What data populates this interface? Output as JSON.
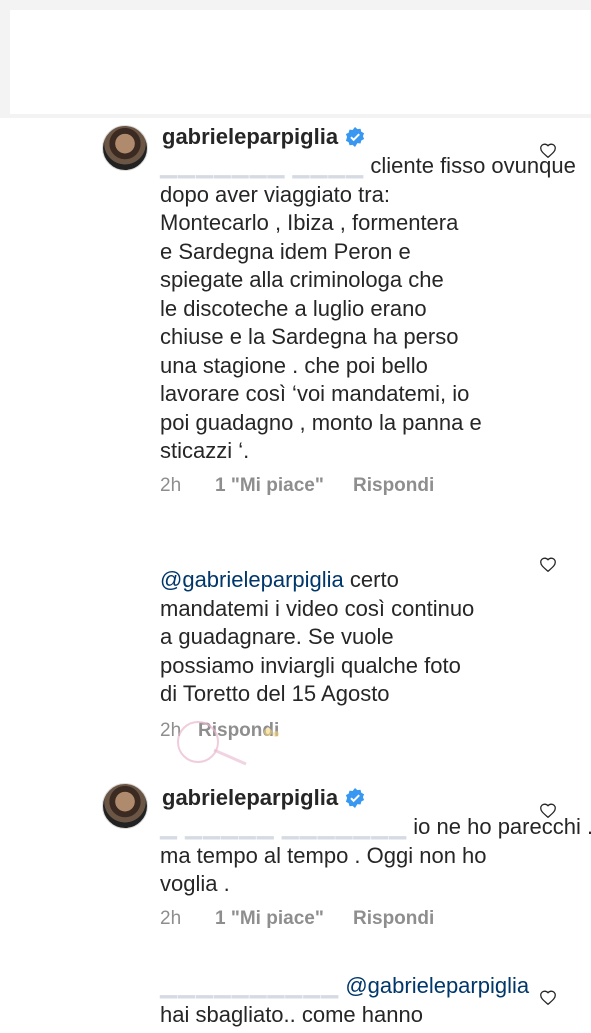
{
  "comments": [
    {
      "username": "gabrieleparpiglia",
      "verified": true,
      "lines": [
        "cliente fisso ovunque",
        "dopo aver viaggiato tra:",
        "Montecarlo , Ibiza , formentera",
        "e Sardegna idem Peron e",
        "spiegate alla criminologa che",
        "le discoteche a luglio erano",
        "chiuse e la Sardegna ha perso",
        "una stagione . che poi bello",
        "lavorare così ‘voi mandatemi, io",
        "poi guadagno , monto la panna e",
        "sticazzi ‘."
      ],
      "time": "2h",
      "likes": "1 \"Mi piace\"",
      "reply": "Rispondi"
    },
    {
      "mention": "@gabrieleparpiglia",
      "first_line_rest": " certo",
      "lines": [
        "mandatemi i video così continuo",
        "a guadagnare. Se vuole",
        "possiamo inviargli qualche foto",
        "di Toretto del 15 Agosto"
      ],
      "time": "2h",
      "reply": "Rispondi"
    },
    {
      "username": "gabrieleparpiglia",
      "verified": true,
      "first_line": "io ne ho parecchi ...",
      "lines": [
        "ma tempo al tempo . Oggi non ho",
        "voglia ."
      ],
      "time": "2h",
      "likes": "1 \"Mi piace\"",
      "reply": "Rispondi"
    },
    {
      "mention": "@gabrieleparpiglia",
      "lines": [
        "hai sbagliato.. come hanno"
      ]
    }
  ],
  "icons": {
    "heart": "heart-outline-icon",
    "verified": "verified-badge-icon"
  },
  "colors": {
    "text": "#262626",
    "meta": "#8e8e8e",
    "mention": "#00376b",
    "verified": "#3897f0"
  }
}
